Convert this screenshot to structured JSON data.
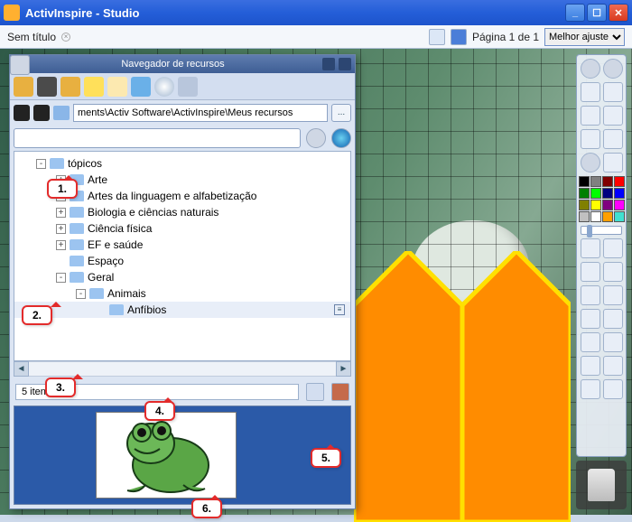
{
  "titlebar": {
    "title": "ActivInspire - Studio"
  },
  "subheader": {
    "docTitle": "Sem título",
    "pageInfo": "Página 1 de 1",
    "zoom": {
      "selected": "Melhor ajuste",
      "options": [
        "Melhor ajuste"
      ]
    }
  },
  "panel": {
    "title": "Navegador de recursos",
    "path": "ments\\Activ Software\\ActivInspire\\Meus recursos",
    "browse": "...",
    "search": "",
    "itemCount": "5 itens",
    "tree": [
      {
        "depth": 0,
        "exp": "-",
        "label": "tópicos"
      },
      {
        "depth": 1,
        "exp": "+",
        "label": "Arte"
      },
      {
        "depth": 1,
        "exp": "+",
        "label": "Artes da linguagem e alfabetização"
      },
      {
        "depth": 1,
        "exp": "+",
        "label": "Biologia e ciências naturais"
      },
      {
        "depth": 1,
        "exp": "+",
        "label": "Ciência física"
      },
      {
        "depth": 1,
        "exp": "+",
        "label": "EF e saúde"
      },
      {
        "depth": 1,
        "exp": "",
        "label": "Espaço"
      },
      {
        "depth": 1,
        "exp": "-",
        "label": "Geral"
      },
      {
        "depth": 2,
        "exp": "-",
        "label": "Animais"
      },
      {
        "depth": 3,
        "exp": "",
        "label": "Anfíbios",
        "selected": true,
        "endIcon": true
      }
    ]
  },
  "callouts": {
    "c1": "1.",
    "c2": "2.",
    "c3": "3.",
    "c4": "4.",
    "c5": "5.",
    "c6": "6."
  },
  "palette": [
    "#000000",
    "#808080",
    "#800000",
    "#ff0000",
    "#008000",
    "#00ff00",
    "#000080",
    "#0000ff",
    "#808000",
    "#ffff00",
    "#800080",
    "#ff00ff",
    "#c0c0c0",
    "#ffffff",
    "#ffa000",
    "#40e0d0"
  ]
}
